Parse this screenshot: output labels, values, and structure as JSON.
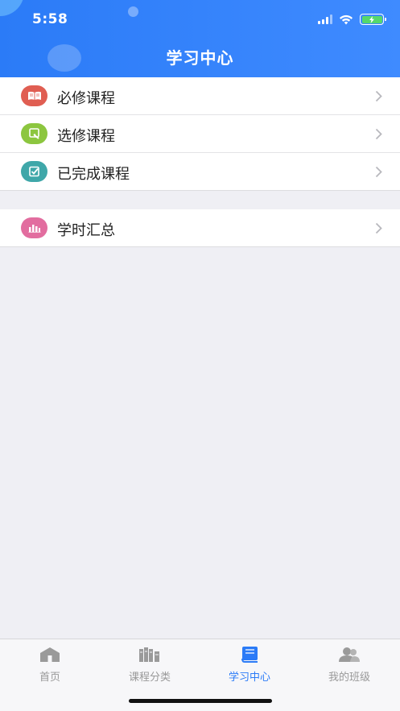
{
  "status_bar": {
    "time": "5:58"
  },
  "header": {
    "title": "学习中心"
  },
  "groups": [
    {
      "items": [
        {
          "label": "必修课程",
          "icon": "book-open-icon",
          "color": "#e05e52"
        },
        {
          "label": "选修课程",
          "icon": "edit-icon",
          "color": "#8cc63f"
        },
        {
          "label": "已完成课程",
          "icon": "checkbox-icon",
          "color": "#3fa7a9"
        }
      ]
    },
    {
      "items": [
        {
          "label": "学时汇总",
          "icon": "bar-chart-icon",
          "color": "#e26d9f"
        }
      ]
    }
  ],
  "tabbar": {
    "active_color": "#2b7bf7",
    "inactive_color": "#999999",
    "items": [
      {
        "label": "首页",
        "icon": "home-icon",
        "active": false
      },
      {
        "label": "课程分类",
        "icon": "books-icon",
        "active": false
      },
      {
        "label": "学习中心",
        "icon": "book-icon",
        "active": true
      },
      {
        "label": "我的班级",
        "icon": "users-icon",
        "active": false
      }
    ]
  }
}
